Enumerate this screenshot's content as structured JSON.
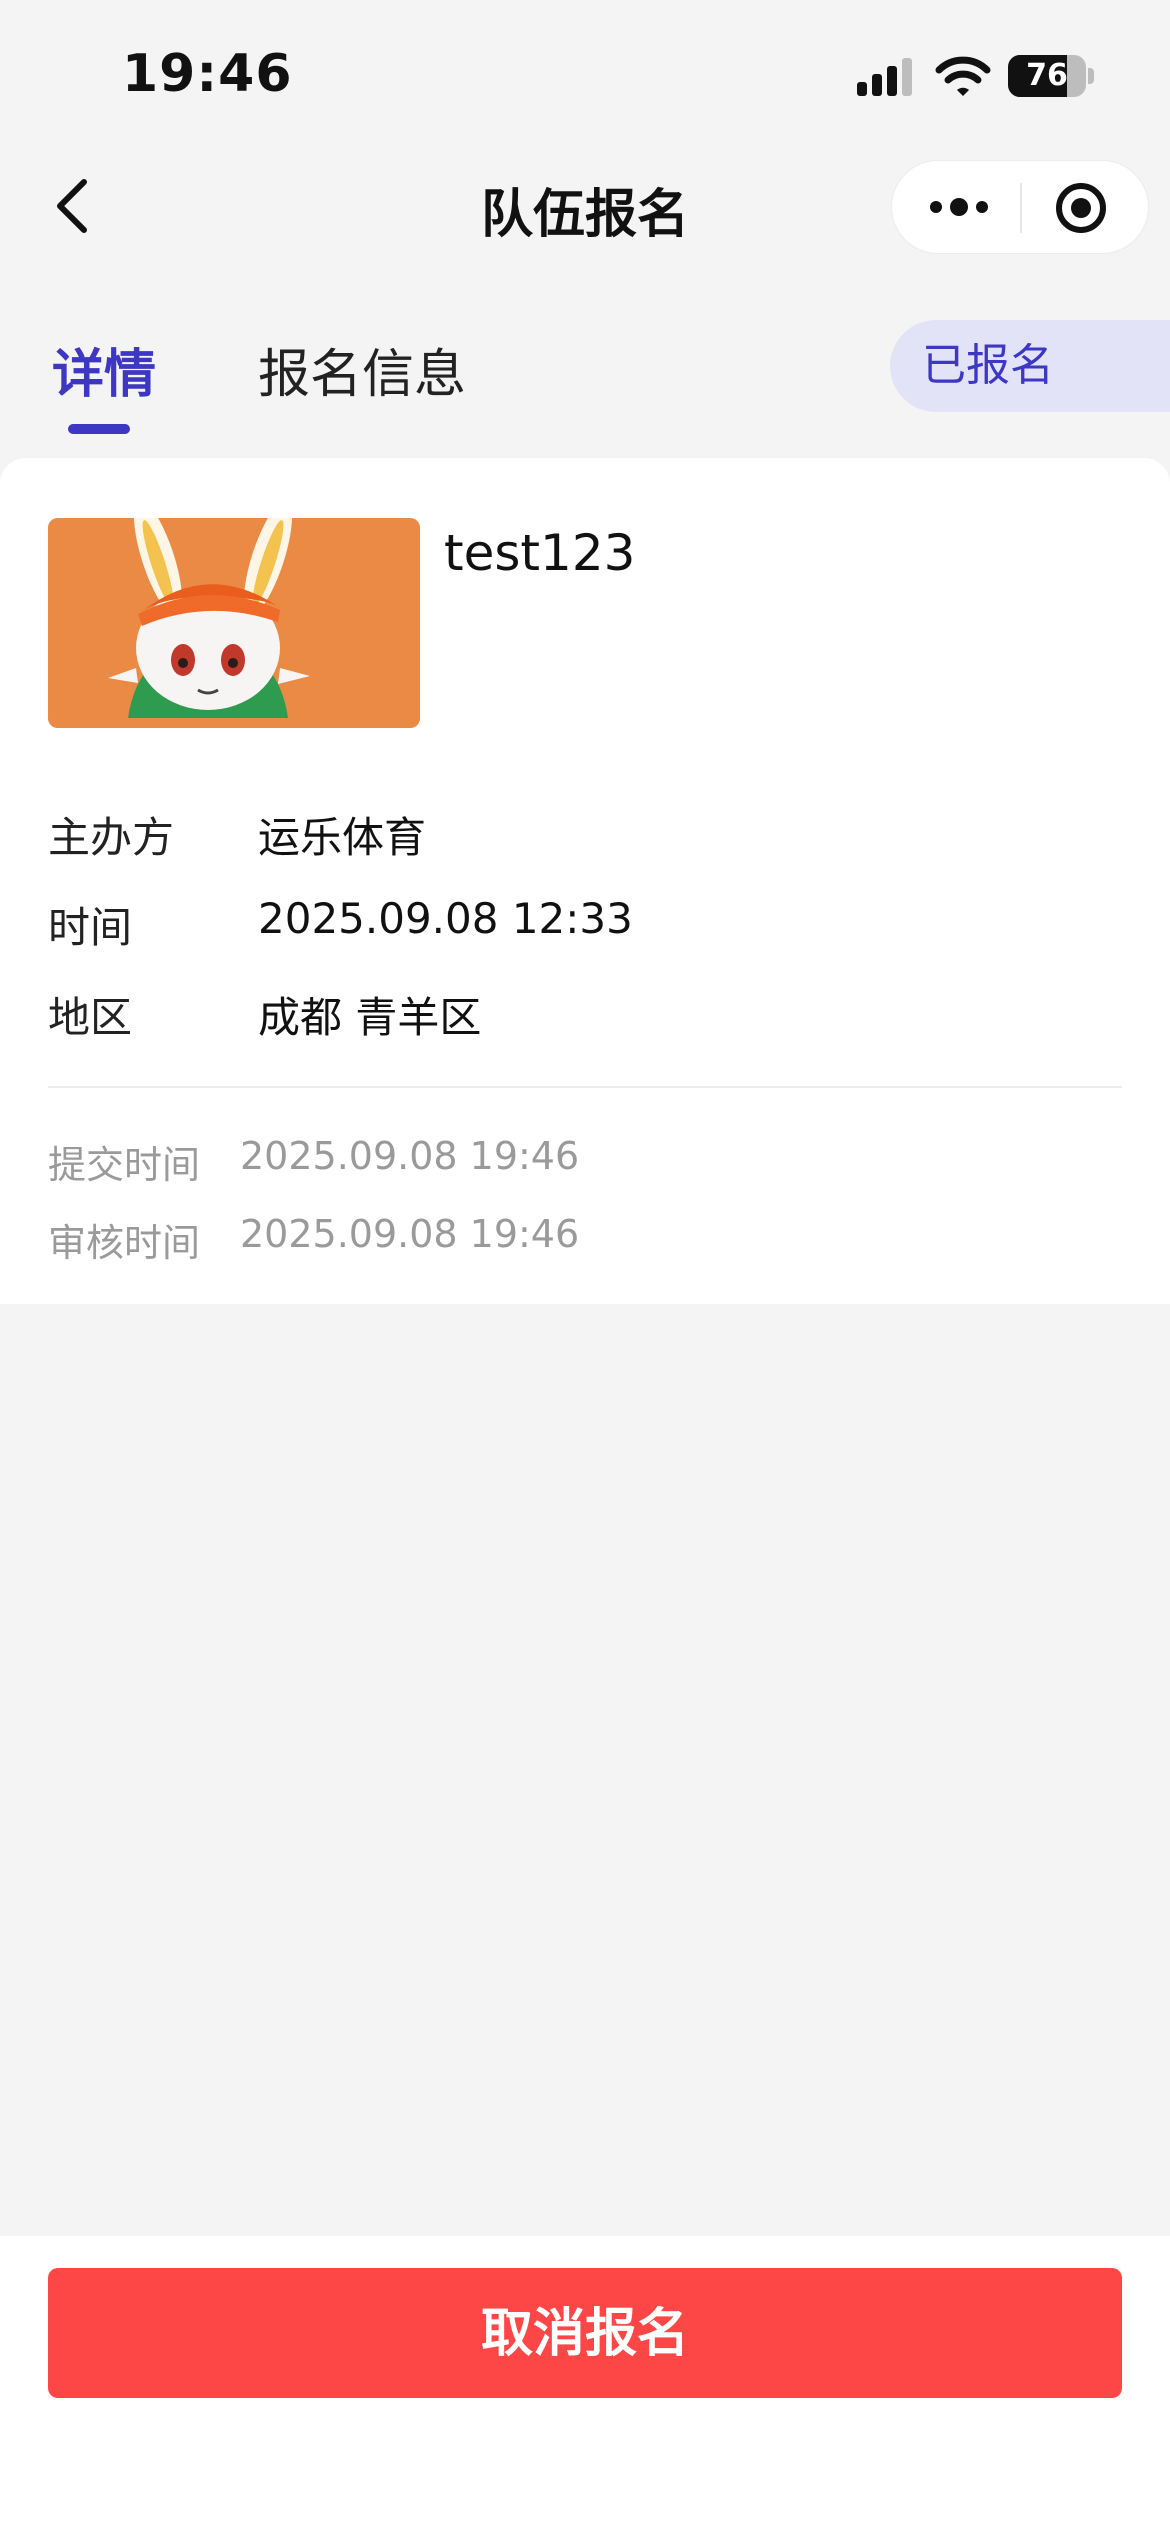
{
  "status_bar": {
    "time": "19:46",
    "battery_level": "76",
    "battery_fraction": 0.76,
    "icons": [
      "cellular-signal-icon",
      "wifi-icon",
      "battery-icon"
    ]
  },
  "nav": {
    "title": "队伍报名",
    "back_icon": "chevron-left-icon",
    "menu_icon": "more-dots-icon",
    "close_icon": "target-close-icon"
  },
  "tabs": [
    {
      "label": "详情",
      "active": true
    },
    {
      "label": "报名信息",
      "active": false
    }
  ],
  "status_badge": "已报名",
  "team": {
    "name": "test123",
    "cover_alt": "orange rabbit character cover image"
  },
  "details": [
    {
      "label": "主办方",
      "value": "运乐体育"
    },
    {
      "label": "时间",
      "value": "2025.09.08 12:33"
    },
    {
      "label": "地区",
      "value": "成都 青羊区"
    }
  ],
  "meta": [
    {
      "label": "提交时间",
      "value": "2025.09.08 19:46"
    },
    {
      "label": "审核时间",
      "value": "2025.09.08 19:46"
    }
  ],
  "footer": {
    "cancel_label": "取消报名"
  },
  "colors": {
    "accent": "#3d37c4",
    "badge_bg": "#e3e3f7",
    "danger": "#fd4747",
    "background": "#f4f4f4"
  }
}
